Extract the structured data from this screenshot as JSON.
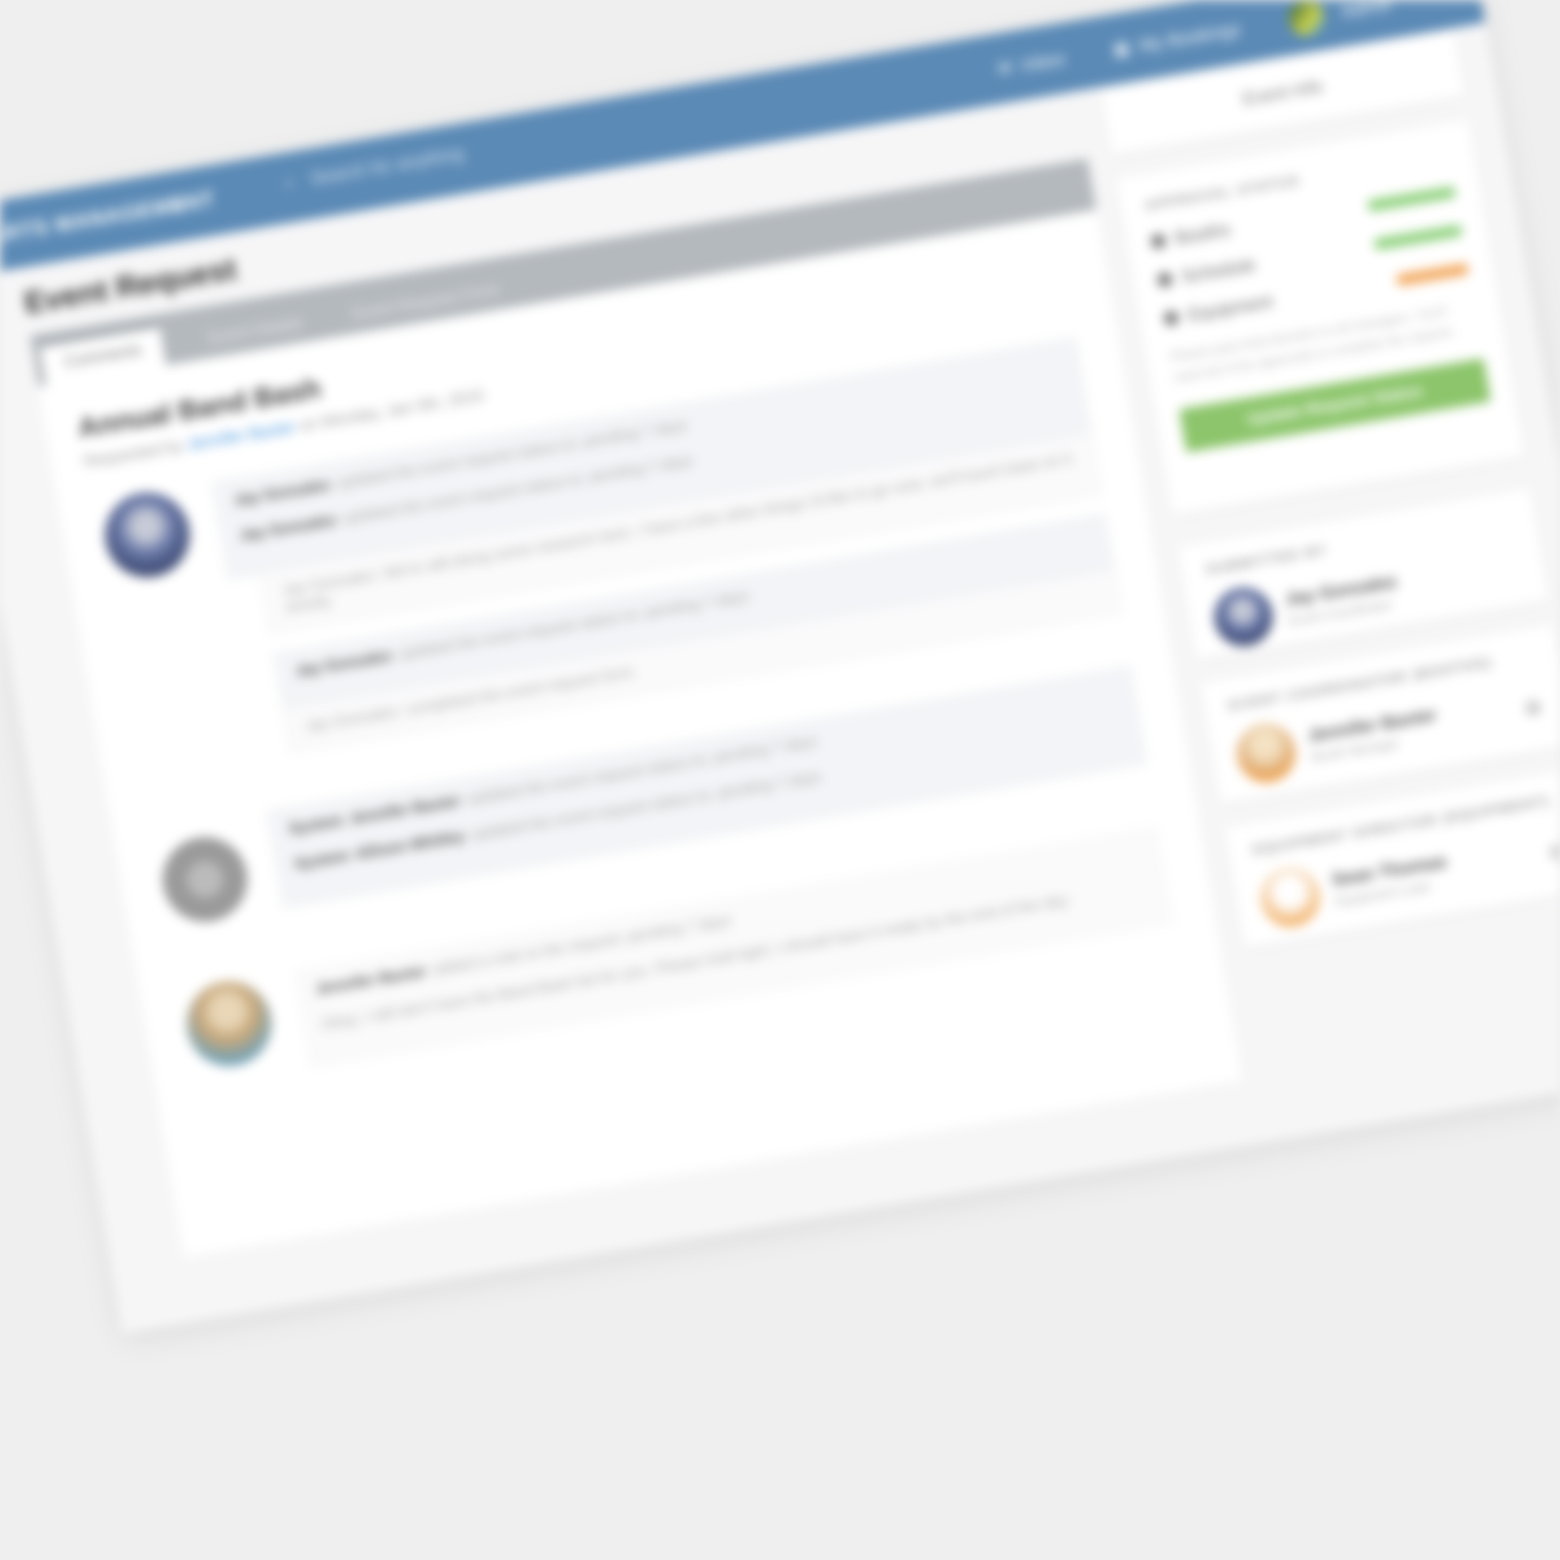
{
  "topbar": {
    "brand": "ARTS MANAGEMENT",
    "menu_icon": "menu-icon",
    "search_placeholder": "Search for anything",
    "links": [
      {
        "icon": "envelope-icon",
        "label": "Inbox"
      },
      {
        "icon": "calendar-icon",
        "label": "My Bookings"
      }
    ],
    "user_label": "Admin"
  },
  "page": {
    "title": "Event Request"
  },
  "tabs": [
    {
      "label": "Comments",
      "active": true
    },
    {
      "label": "Event Details",
      "active": false
    },
    {
      "label": "Event Request Form",
      "active": false
    }
  ],
  "event": {
    "title": "Annual Band Bash",
    "meta_prefix": "Requested by",
    "requester": "Jennifer Baxter",
    "meta_suffix": "on Monday, Jan 5th, 2015"
  },
  "thread": {
    "comments": [
      {
        "author": "Jay Gonzalez",
        "text": "updated the event request status to: pending 7 days"
      },
      {
        "author": "Jay Gonzalez",
        "text": "updated the event request status to: pending 7 days"
      }
    ],
    "reply1": "Jay Gonzalez: We're still doing some research here. I have a few other things I'd like to go over, we'll touch base on it shortly.",
    "comment3": {
      "author": "Jay Gonzalez",
      "text": "updated the event request status to: pending 7 days"
    },
    "reply2": "Jay Gonzalez: completed the event request form.",
    "system_comments": [
      {
        "author": "System",
        "actor": "Jennifer Baxter",
        "text": "updated the event request status to: pending 7 days"
      },
      {
        "author": "System",
        "actor": "Allison Whitley",
        "text": "updated the event request status to: pending 7 days"
      }
    ],
    "last_comment": {
      "author": "Jennifer Baxter",
      "text": "added a note to the request: pending 7 days"
    },
    "last_note": "Okay, I still don't have the Band Bash list for you. Please hold tight; I should have it ready by the end of the day."
  },
  "sidebar": {
    "header": "Event Info",
    "approval": {
      "title": "Approval Status",
      "rows": [
        {
          "icon": "circle-icon",
          "label": "Booths",
          "color": "#8cd07a"
        },
        {
          "icon": "circle-icon",
          "label": "Schedule",
          "color": "#8cd07a"
        },
        {
          "icon": "circle-icon",
          "label": "Equipment",
          "color": "#f2a65a"
        }
      ],
      "note": "Please pass final decision to all managers. You'll need all of the approvals to complete the request.",
      "button": "Update Request Status"
    },
    "submitter": {
      "title": "Submitted By",
      "name": "Jay Gonzalez",
      "sub": "Event Coordinator"
    },
    "booth": {
      "title": "Event Coordinator (Booths)",
      "name": "Jennifer Baxter",
      "sub": "Booth Manager"
    },
    "equipment": {
      "title": "Equipment Director (Equipment)",
      "name": "Sean Thomas",
      "sub": "Equipment Lead"
    }
  }
}
